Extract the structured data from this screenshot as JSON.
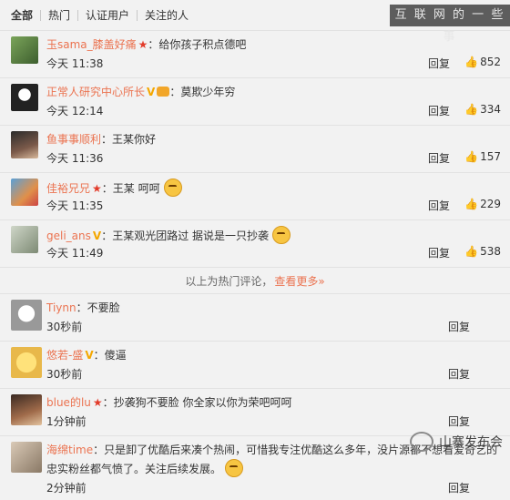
{
  "tabs": [
    "全部",
    "热门",
    "认证用户",
    "关注的人"
  ],
  "watermark": "互 联 网 的 一 些 事",
  "hot_comments": [
    {
      "user": "玉sama_膝盖好痛",
      "badge": "star",
      "text": "：给你孩子积点德吧",
      "time": "今天 11:38",
      "likes": "852",
      "emoji": false
    },
    {
      "user": "正常人研究中心所长",
      "badge": "v-crown",
      "text": "：莫欺少年穷",
      "time": "今天 12:14",
      "likes": "334",
      "emoji": false
    },
    {
      "user": "鱼事事顺利",
      "badge": "",
      "text": "：王某你好",
      "time": "今天 11:36",
      "likes": "157",
      "emoji": false
    },
    {
      "user": "佳裕兄兄",
      "badge": "star",
      "text": "：王某 呵呵",
      "time": "今天 11:35",
      "likes": "229",
      "emoji": true
    },
    {
      "user": "geli_ans",
      "badge": "v",
      "text": "：王某观光团路过 据说是一只抄袭",
      "time": "今天 11:49",
      "likes": "538",
      "emoji": true
    }
  ],
  "divider": {
    "text": "以上为热门评论，",
    "more": "查看更多»"
  },
  "new_comments": [
    {
      "user": "Tiynn",
      "badge": "",
      "text": "：不要脸",
      "time": "30秒前"
    },
    {
      "user": "悠若-盛",
      "badge": "v",
      "text": "：傻逼",
      "time": "30秒前"
    },
    {
      "user": "blue的lu",
      "badge": "star",
      "text": "：抄袭狗不要脸 你全家以你为荣吧呵呵",
      "time": "1分钟前"
    }
  ],
  "last_comment": {
    "user": "海绵time",
    "text": "：只是卸了优酷后来凑个热闹，可惜我专注优酷这么多年，没片源都不想看爱奇艺的忠实粉丝都气愤了。关注后续发展。",
    "time": "2分钟前"
  },
  "reply_label": "回复",
  "brand": "山寨发布会",
  "colors": {
    "username": "#eb7350",
    "star": "#e23b2a",
    "vip": "#f4a700"
  }
}
